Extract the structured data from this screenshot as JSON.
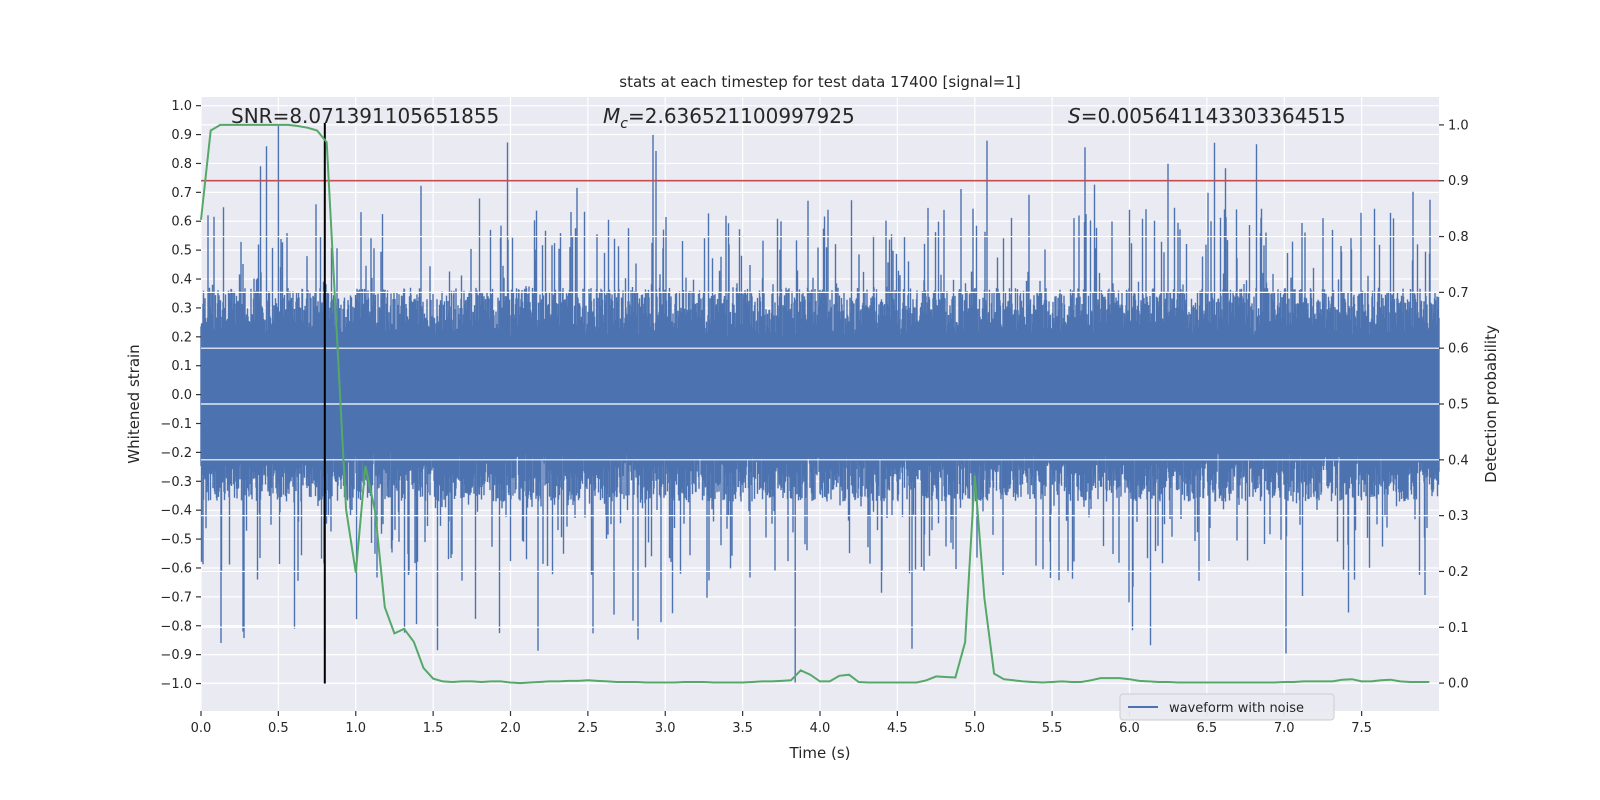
{
  "chart_data": {
    "type": "line",
    "title": "stats at each timestep for test data 17400 [signal=1]",
    "xlabel": "Time (s)",
    "ylabel_left": "Whitened strain",
    "ylabel_right": "Detection probability",
    "xlim": [
      0,
      8.0
    ],
    "ylim_left": [
      -1.095,
      1.03
    ],
    "ylim_right": [
      -0.05,
      1.05
    ],
    "xticks": [
      "0.0",
      "0.5",
      "1.0",
      "1.5",
      "2.0",
      "2.5",
      "3.0",
      "3.5",
      "4.0",
      "4.5",
      "5.0",
      "5.5",
      "6.0",
      "6.5",
      "7.0",
      "7.5"
    ],
    "yticks_left": [
      "1.0",
      "0.9",
      "0.8",
      "0.7",
      "0.6",
      "0.5",
      "0.4",
      "0.3",
      "0.2",
      "0.1",
      "0.0",
      "−0.1",
      "−0.2",
      "−0.3",
      "−0.4",
      "−0.5",
      "−0.6",
      "−0.7",
      "−0.8",
      "−0.9",
      "−1.0"
    ],
    "yticks_right": [
      "1.0",
      "0.9",
      "0.8",
      "0.7",
      "0.6",
      "0.5",
      "0.4",
      "0.3",
      "0.2",
      "0.1",
      "0.0"
    ],
    "grid": true,
    "background": "#eaeaf2",
    "annotations": {
      "snr": {
        "label": "SNR",
        "value": "8.071391105651855"
      },
      "mc": {
        "symbol": "M",
        "subscript": "c",
        "value": "2.636521100997925"
      },
      "s": {
        "symbol": "S",
        "value": "0.005641143303364515"
      }
    },
    "waveform": {
      "name": "waveform with noise",
      "axis": "left",
      "color": "#4c72b0",
      "typical_range": [
        -0.35,
        0.35
      ],
      "peak_range": [
        -1.0,
        0.93
      ]
    },
    "probability": {
      "axis": "right",
      "color": "#55a868",
      "dt": 0.0625,
      "values": [
        0.83,
        0.99,
        1.0,
        1.0,
        1.0,
        1.0,
        1.0,
        1.0,
        1.0,
        1.0,
        0.998,
        0.995,
        0.99,
        0.969,
        0.64,
        0.311,
        0.198,
        0.389,
        0.308,
        0.136,
        0.089,
        0.097,
        0.074,
        0.027,
        0.008,
        0.003,
        0.002,
        0.003,
        0.003,
        0.002,
        0.003,
        0.003,
        0.001,
        0.0,
        0.001,
        0.002,
        0.003,
        0.003,
        0.004,
        0.004,
        0.005,
        0.004,
        0.003,
        0.002,
        0.002,
        0.002,
        0.001,
        0.001,
        0.001,
        0.001,
        0.002,
        0.002,
        0.002,
        0.001,
        0.001,
        0.001,
        0.001,
        0.002,
        0.003,
        0.003,
        0.004,
        0.005,
        0.023,
        0.015,
        0.003,
        0.003,
        0.013,
        0.015,
        0.002,
        0.001,
        0.001,
        0.001,
        0.001,
        0.001,
        0.001,
        0.005,
        0.012,
        0.011,
        0.01,
        0.073,
        0.372,
        0.152,
        0.017,
        0.007,
        0.005,
        0.003,
        0.002,
        0.001,
        0.002,
        0.003,
        0.002,
        0.002,
        0.005,
        0.009,
        0.009,
        0.009,
        0.007,
        0.004,
        0.003,
        0.002,
        0.002,
        0.001,
        0.001,
        0.001,
        0.001,
        0.001,
        0.001,
        0.001,
        0.001,
        0.001,
        0.001,
        0.001,
        0.002,
        0.002,
        0.003,
        0.003,
        0.003,
        0.003,
        0.006,
        0.007,
        0.003,
        0.003,
        0.005,
        0.006,
        0.003,
        0.002,
        0.002,
        0.002
      ]
    },
    "threshold": {
      "axis": "right",
      "value": 0.9,
      "color": "#c44e52"
    },
    "marker_time": {
      "value": 0.8,
      "color": "#000000"
    },
    "legend": {
      "placement": "lower-right",
      "entries": [
        "waveform with noise"
      ]
    }
  }
}
